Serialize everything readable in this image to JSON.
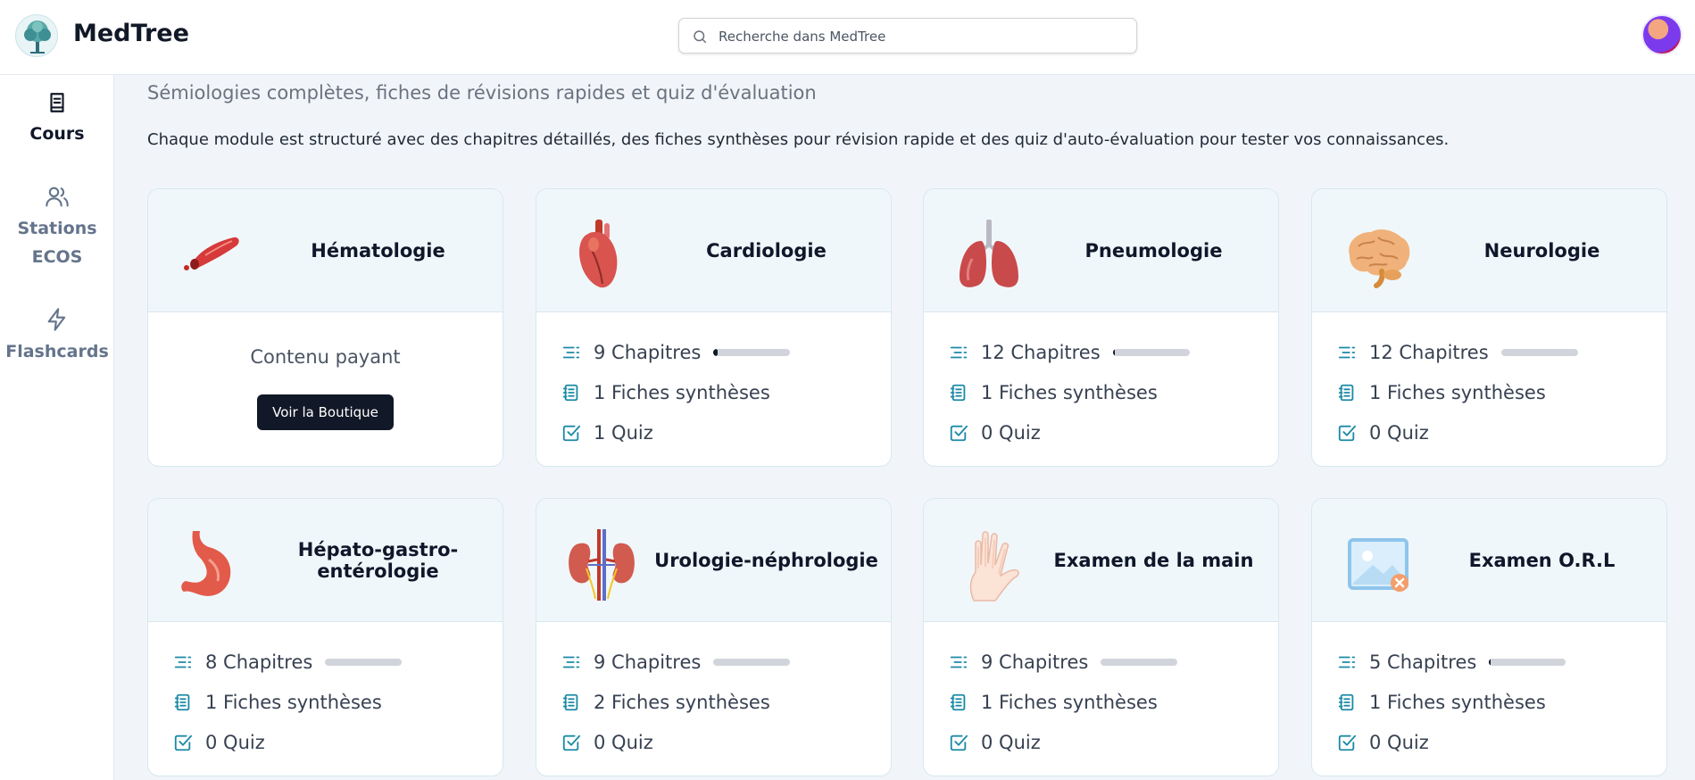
{
  "header": {
    "brand": "MedTree",
    "search_placeholder": "Recherche dans MedTree"
  },
  "sidebar": {
    "items": [
      {
        "label": "Cours",
        "icon": "book-icon",
        "active": true
      },
      {
        "label": "Stations ECOS",
        "icon": "users-icon",
        "active": false
      },
      {
        "label": "Flashcards",
        "icon": "zap-icon",
        "active": false
      }
    ]
  },
  "main": {
    "subtitle": "Sémiologies complètes, fiches de révisions rapides et quiz d'évaluation",
    "description": "Chaque module est structuré avec des chapitres détaillés, des fiches synthèses pour révision rapide et des quiz d'auto-évaluation pour tester vos connaissances.",
    "modules": [
      {
        "title": "Hématologie",
        "image": "red-blood-vessel",
        "paid": true,
        "paid_label": "Contenu payant",
        "button_label": "Voir la Boutique"
      },
      {
        "title": "Cardiologie",
        "image": "heart",
        "chapters": "9 Chapitres",
        "progress": 0.05,
        "fiches": "1 Fiches synthèses",
        "quiz": "1 Quiz"
      },
      {
        "title": "Pneumologie",
        "image": "lungs",
        "chapters": "12 Chapitres",
        "progress": 0.03,
        "fiches": "1 Fiches synthèses",
        "quiz": "0 Quiz"
      },
      {
        "title": "Neurologie",
        "image": "brain",
        "chapters": "12 Chapitres",
        "progress": 0.0,
        "fiches": "1 Fiches synthèses",
        "quiz": "0 Quiz"
      },
      {
        "title": "Hépato-gastro-entérologie",
        "image": "stomach",
        "chapters": "8 Chapitres",
        "progress": 0.0,
        "fiches": "1 Fiches synthèses",
        "quiz": "0 Quiz"
      },
      {
        "title": "Urologie-néphrologie",
        "image": "kidneys",
        "chapters": "9 Chapitres",
        "progress": 0.0,
        "fiches": "2 Fiches synthèses",
        "quiz": "0 Quiz"
      },
      {
        "title": "Examen de la main",
        "image": "hand-skeleton",
        "chapters": "9 Chapitres",
        "progress": 0.0,
        "fiches": "1 Fiches synthèses",
        "quiz": "0 Quiz"
      },
      {
        "title": "Examen O.R.L",
        "image": "broken-image",
        "chapters": "5 Chapitres",
        "progress": 0.02,
        "fiches": "1 Fiches synthèses",
        "quiz": "0 Quiz"
      }
    ]
  },
  "colors": {
    "accent": "#1c8aa6",
    "button": "#111827",
    "card_header": "#f0f7fa"
  }
}
